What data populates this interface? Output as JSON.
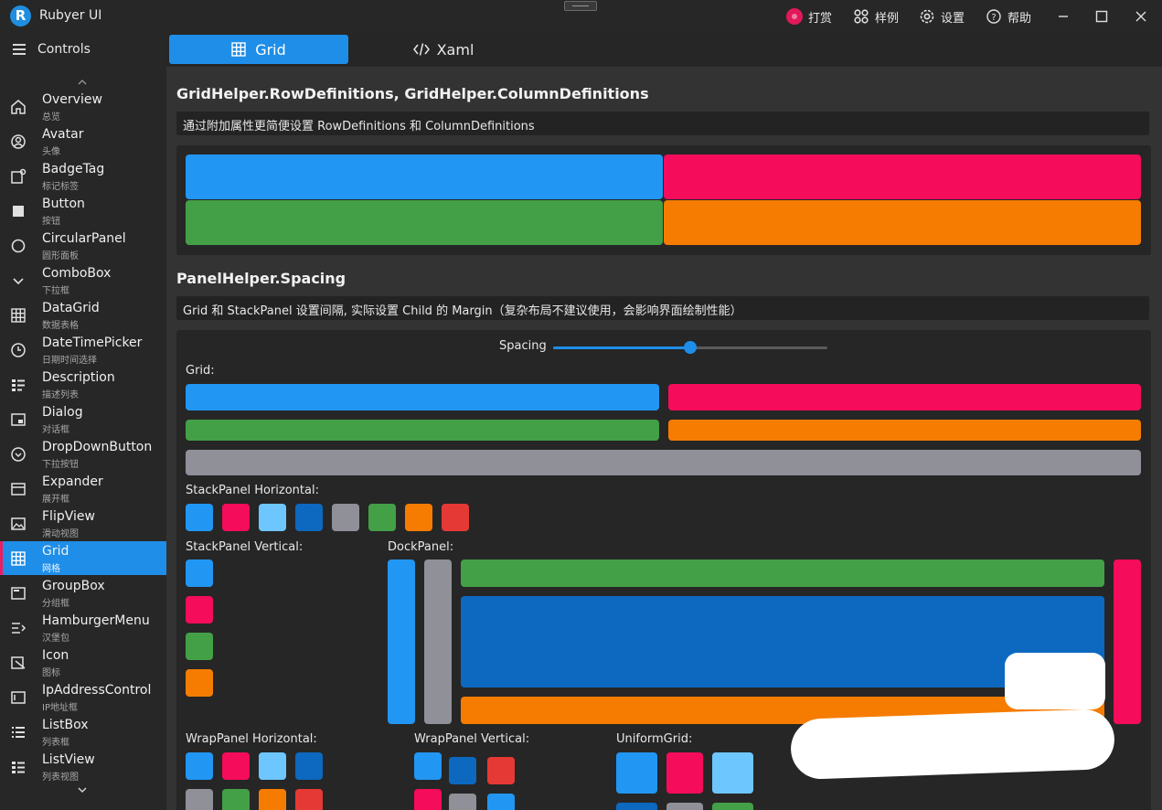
{
  "app": {
    "title": "Rubyer UI",
    "logo_letter": "R"
  },
  "titlebar": {
    "actions": [
      {
        "label": "打赏",
        "icon": "reward-icon"
      },
      {
        "label": "样例",
        "icon": "grid-dots-icon"
      },
      {
        "label": "设置",
        "icon": "gear-icon"
      },
      {
        "label": "帮助",
        "icon": "help-icon"
      }
    ],
    "window_controls": [
      "minimize",
      "maximize",
      "close"
    ]
  },
  "sidebar": {
    "header_label": "Controls",
    "items": [
      {
        "label": "Overview",
        "sub": "总览",
        "icon": "home-icon"
      },
      {
        "label": "Avatar",
        "sub": "头像",
        "icon": "user-circle-icon"
      },
      {
        "label": "BadgeTag",
        "sub": "标记标签",
        "icon": "badge-icon"
      },
      {
        "label": "Button",
        "sub": "按钮",
        "icon": "square-icon"
      },
      {
        "label": "CircularPanel",
        "sub": "圆形面板",
        "icon": "circle-icon"
      },
      {
        "label": "ComboBox",
        "sub": "下拉框",
        "icon": "chevron-down-icon"
      },
      {
        "label": "DataGrid",
        "sub": "数据表格",
        "icon": "table-icon"
      },
      {
        "label": "DateTimePicker",
        "sub": "日期时间选择",
        "icon": "clock-icon"
      },
      {
        "label": "Description",
        "sub": "描述列表",
        "icon": "description-list-icon"
      },
      {
        "label": "Dialog",
        "sub": "对话框",
        "icon": "dialog-icon"
      },
      {
        "label": "DropDownButton",
        "sub": "下拉按钮",
        "icon": "dropdown-circle-icon"
      },
      {
        "label": "Expander",
        "sub": "展开框",
        "icon": "expander-icon"
      },
      {
        "label": "FlipView",
        "sub": "滑动视图",
        "icon": "image-icon"
      },
      {
        "label": "Grid",
        "sub": "网格",
        "icon": "grid-icon",
        "active": true
      },
      {
        "label": "GroupBox",
        "sub": "分组框",
        "icon": "groupbox-icon"
      },
      {
        "label": "HamburgerMenu",
        "sub": "汉堡包",
        "icon": "hamburger-menu-icon"
      },
      {
        "label": "Icon",
        "sub": "图标",
        "icon": "icon-edit-icon"
      },
      {
        "label": "IpAddressControl",
        "sub": "IP地址框",
        "icon": "ip-address-icon"
      },
      {
        "label": "ListBox",
        "sub": "列表框",
        "icon": "list-icon"
      },
      {
        "label": "ListView",
        "sub": "列表视图",
        "icon": "list-view-icon"
      }
    ]
  },
  "tabs": [
    {
      "label": "Grid",
      "icon": "grid-icon",
      "active": true
    },
    {
      "label": "Xaml",
      "icon": "code-icon",
      "active": false
    }
  ],
  "section1": {
    "title": "GridHelper.RowDefinitions, GridHelper.ColumnDefinitions",
    "description": "通过附加属性更简便设置 RowDefinitions 和 ColumnDefinitions"
  },
  "section2": {
    "title": "PanelHelper.Spacing",
    "description": "Grid 和 StackPanel 设置间隔, 实际设置 Child 的 Margin（复杂布局不建议使用，会影响界面绘制性能）",
    "spacing_label": "Spacing",
    "spacing_value": 0.5,
    "grid_label": "Grid:",
    "stack_h_label": "StackPanel Horizontal:",
    "stack_v_label": "StackPanel Vertical:",
    "dock_label": "DockPanel:",
    "wrap_h_label": "WrapPanel Horizontal:",
    "wrap_v_label": "WrapPanel Vertical:",
    "uniform_label": "UniformGrid:"
  },
  "colors": {
    "accent": "#1e8ee8",
    "blue": "#2196f3",
    "pink": "#f50c5a",
    "green": "#43a047",
    "orange": "#f57c00",
    "gray": "#8f9098",
    "light_blue": "#6ec6ff",
    "dark_blue": "#0d68c0",
    "red": "#e53935"
  }
}
